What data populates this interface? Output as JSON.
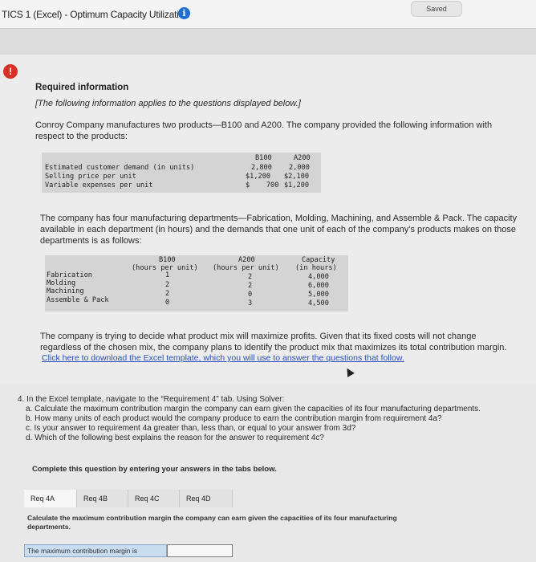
{
  "header": {
    "title": "TICS 1 (Excel) - Optimum Capacity Utilization",
    "info_icon": "i",
    "status": "Saved"
  },
  "alert_icon": "!",
  "required_info": {
    "title": "Required information",
    "note": "[The following information applies to the questions displayed below.]"
  },
  "intro": {
    "line1": "Conroy Company manufactures two products—B100 and A200. The company provided the following information with",
    "line2": "respect to the products:"
  },
  "product_table": {
    "headers": [
      "B100",
      "A200"
    ],
    "rows": [
      {
        "label": "Estimated customer demand (in units)",
        "b100": "2,800",
        "a200": "2,000"
      },
      {
        "label": "Selling price per unit",
        "b100": "$1,200",
        "a200": "$2,100"
      },
      {
        "label": "Variable expenses per unit",
        "b100": "$    700",
        "a200": "$1,200"
      }
    ]
  },
  "dept_intro": {
    "line1": "The company has four manufacturing departments—Fabrication, Molding, Machining, and Assemble & Pack. The capacity",
    "line2": "available in each department (in hours) and the demands that one unit of each of the company’s products makes on those",
    "line3": "departments is as follows:"
  },
  "dept_table": {
    "headers": {
      "b100_top": "B100",
      "b100_sub": "(hours per unit)",
      "a200_top": "A200",
      "a200_sub": "(hours per unit)",
      "cap_top": "Capacity",
      "cap_sub": "(in hours)"
    },
    "rows": [
      {
        "label": "Fabrication",
        "b100": "1",
        "a200": "2",
        "cap": "4,000"
      },
      {
        "label": "Molding",
        "b100": "2",
        "a200": "2",
        "cap": "6,000"
      },
      {
        "label": "Machining",
        "b100": "2",
        "a200": "0",
        "cap": "5,000"
      },
      {
        "label": "Assemble & Pack",
        "b100": "0",
        "a200": "3",
        "cap": "4,500"
      }
    ]
  },
  "decision": {
    "line1": "The company is trying to decide what product mix will maximize profits. Given that its fixed costs will not change",
    "line2": "regardless of the chosen mix, the company plans to identify the product mix that maximizes its total contribution margin."
  },
  "link_text": "Click here to download the Excel template, which you will use to answer the questions that follow.",
  "question": {
    "line0": "4. In the Excel template, navigate to the “Requirement 4” tab. Using Solver:",
    "line1": "a. Calculate the maximum contribution margin the company can earn given the capacities of its four manufacturing departments.",
    "line2": "b. How many units of each product would the company produce to earn the contribution margin from requirement 4a?",
    "line3": "c. Is your answer to requirement 4a greater than, less than, or equal to your answer from 3d?",
    "line4": "d. Which of the following best explains the reason for the answer to requirement 4c?"
  },
  "complete_instruction": "Complete this question by entering your answers in the tabs below.",
  "tabs": [
    "Req 4A",
    "Req 4B",
    "Req 4C",
    "Req 4D"
  ],
  "tab_instruction": {
    "line1": "Calculate the maximum contribution margin the company can earn given the capacities of its four manufacturing",
    "line2": "departments."
  },
  "answer_row": {
    "label": "The maximum contribution margin is",
    "value": ""
  }
}
